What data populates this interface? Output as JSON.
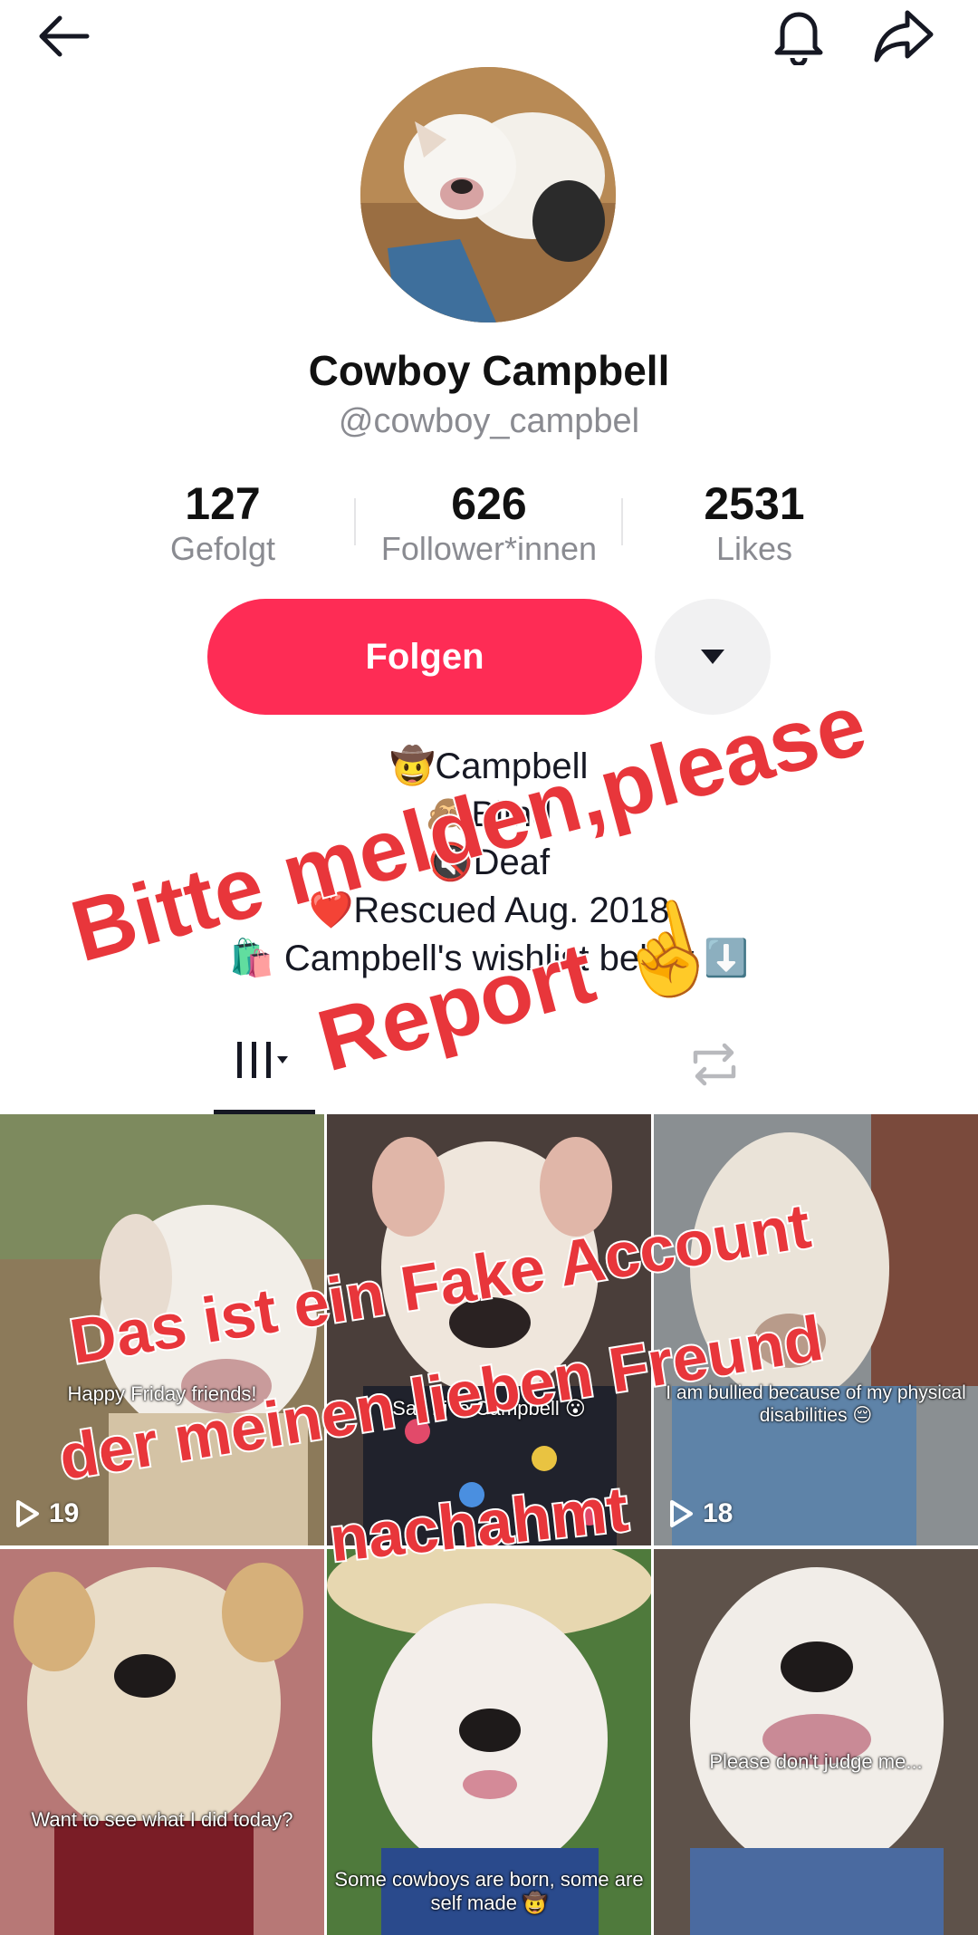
{
  "profile": {
    "name": "Cowboy Campbell",
    "handle": "@cowboy_campbel"
  },
  "stats": [
    {
      "value": "127",
      "label": "Gefolgt"
    },
    {
      "value": "626",
      "label": "Follower*innen"
    },
    {
      "value": "2531",
      "label": "Likes"
    }
  ],
  "actions": {
    "follow_label": "Folgen"
  },
  "bio": [
    "🤠Campbell",
    "🙈Blind",
    "🔇Deaf",
    "❤️Rescued Aug. 2018",
    "🛍️ Campbell's wishlist below ⬇️"
  ],
  "overlay": {
    "line1": "Bitte melden,please",
    "line2": "Report ☝️",
    "line3": "Das ist ein Fake Account",
    "line4": "der meinen  lieben Freund",
    "line5": "nachahmt"
  },
  "videos": [
    {
      "caption": "Happy Friday friends!",
      "views": "19"
    },
    {
      "caption": "Say hi to Campbell 😮",
      "views": ""
    },
    {
      "caption": "I am bullied because of my physical disabilities 😔",
      "views": "18"
    },
    {
      "caption": "Want to see what I did today?",
      "views": ""
    },
    {
      "caption": "Some cowboys are born, some are self made 🤠",
      "views": ""
    },
    {
      "caption": "Please don't judge me...",
      "views": ""
    }
  ],
  "colors": {
    "accent": "#fe2c55",
    "overlay_text": "#e8363b",
    "muted": "#8a8b91"
  },
  "icons": [
    "back-arrow-icon",
    "bell-icon",
    "share-icon",
    "dropdown-triangle-icon",
    "grid-icon",
    "repost-icon",
    "play-icon"
  ]
}
